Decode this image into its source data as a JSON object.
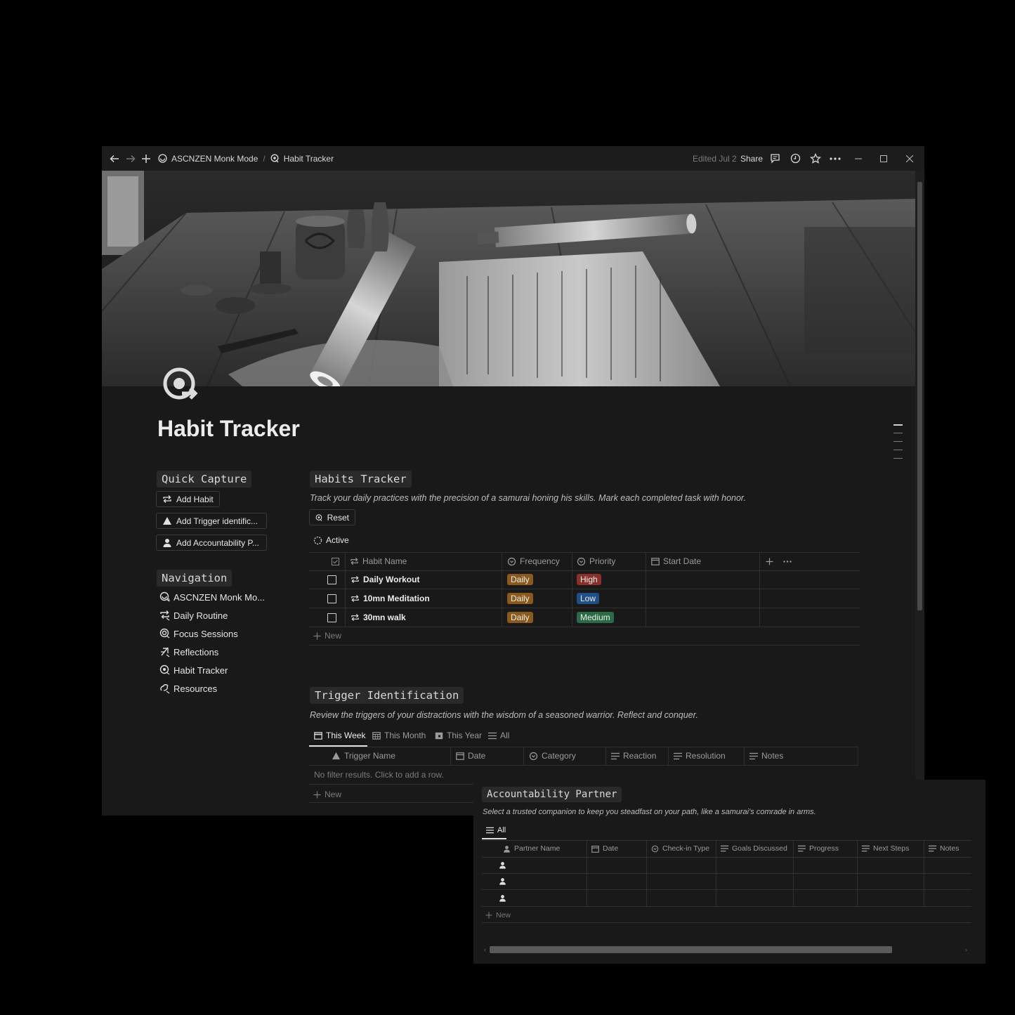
{
  "window": {
    "breadcrumb": {
      "workspace": "ASCNZEN Monk Mode",
      "separator": "/",
      "page": "Habit Tracker"
    },
    "edited": "Edited Jul 2",
    "share_label": "Share"
  },
  "page": {
    "title": "Habit Tracker"
  },
  "quick_capture": {
    "heading": "Quick Capture",
    "buttons": [
      "Add Habit",
      "Add Trigger identific...",
      "Add Accountability P..."
    ]
  },
  "navigation": {
    "heading": "Navigation",
    "items": [
      "ASCNZEN Monk Mo...",
      "Daily Routine",
      "Focus Sessions",
      "Reflections",
      "Habit Tracker",
      "Resources"
    ]
  },
  "habits": {
    "heading": "Habits Tracker",
    "description": "Track your daily practices with the precision of a samurai honing his skills. Mark each completed task with honor.",
    "reset_label": "Reset",
    "view_label": "Active",
    "columns": [
      "Habit Name",
      "Frequency",
      "Priority",
      "Start Date"
    ],
    "rows": [
      {
        "name": "Daily Workout",
        "frequency": "Daily",
        "priority": "High",
        "start_date": ""
      },
      {
        "name": "10mn Meditation",
        "frequency": "Daily",
        "priority": "Low",
        "start_date": ""
      },
      {
        "name": "30mn walk",
        "frequency": "Daily",
        "priority": "Medium",
        "start_date": ""
      }
    ],
    "new_label": "New"
  },
  "triggers": {
    "heading": "Trigger Identification",
    "description": "Review the triggers of your distractions with the wisdom of a seasoned warrior. Reflect and conquer.",
    "tabs": [
      "This Week",
      "This Month",
      "This Year",
      "All"
    ],
    "columns": [
      "Trigger Name",
      "Date",
      "Category",
      "Reaction",
      "Resolution",
      "Notes"
    ],
    "empty_text": "No filter results. Click to add a row.",
    "new_label": "New"
  },
  "accountability": {
    "heading": "Accountability Partner",
    "description": "Select a trusted companion to keep you steadfast on your path, like a samurai's comrade in arms.",
    "view_label": "All",
    "columns": [
      "Partner Name",
      "Date",
      "Check-in Type",
      "Goals Discussed",
      "Progress",
      "Next Steps",
      "Notes"
    ],
    "new_label": "New"
  },
  "colors": {
    "tag_daily": "#8a5a1c",
    "tag_high": "#8a2f2a",
    "tag_low": "#1f4f86",
    "tag_medium": "#2a6a44",
    "background": "#191919"
  },
  "icons": [
    "back-arrow-icon",
    "forward-arrow-icon",
    "plus-icon",
    "comment-icon",
    "clock-icon",
    "star-icon",
    "more-icon",
    "repeat-icon",
    "warning-icon",
    "person-icon",
    "calendar-icon",
    "select-icon",
    "text-lines-icon"
  ]
}
